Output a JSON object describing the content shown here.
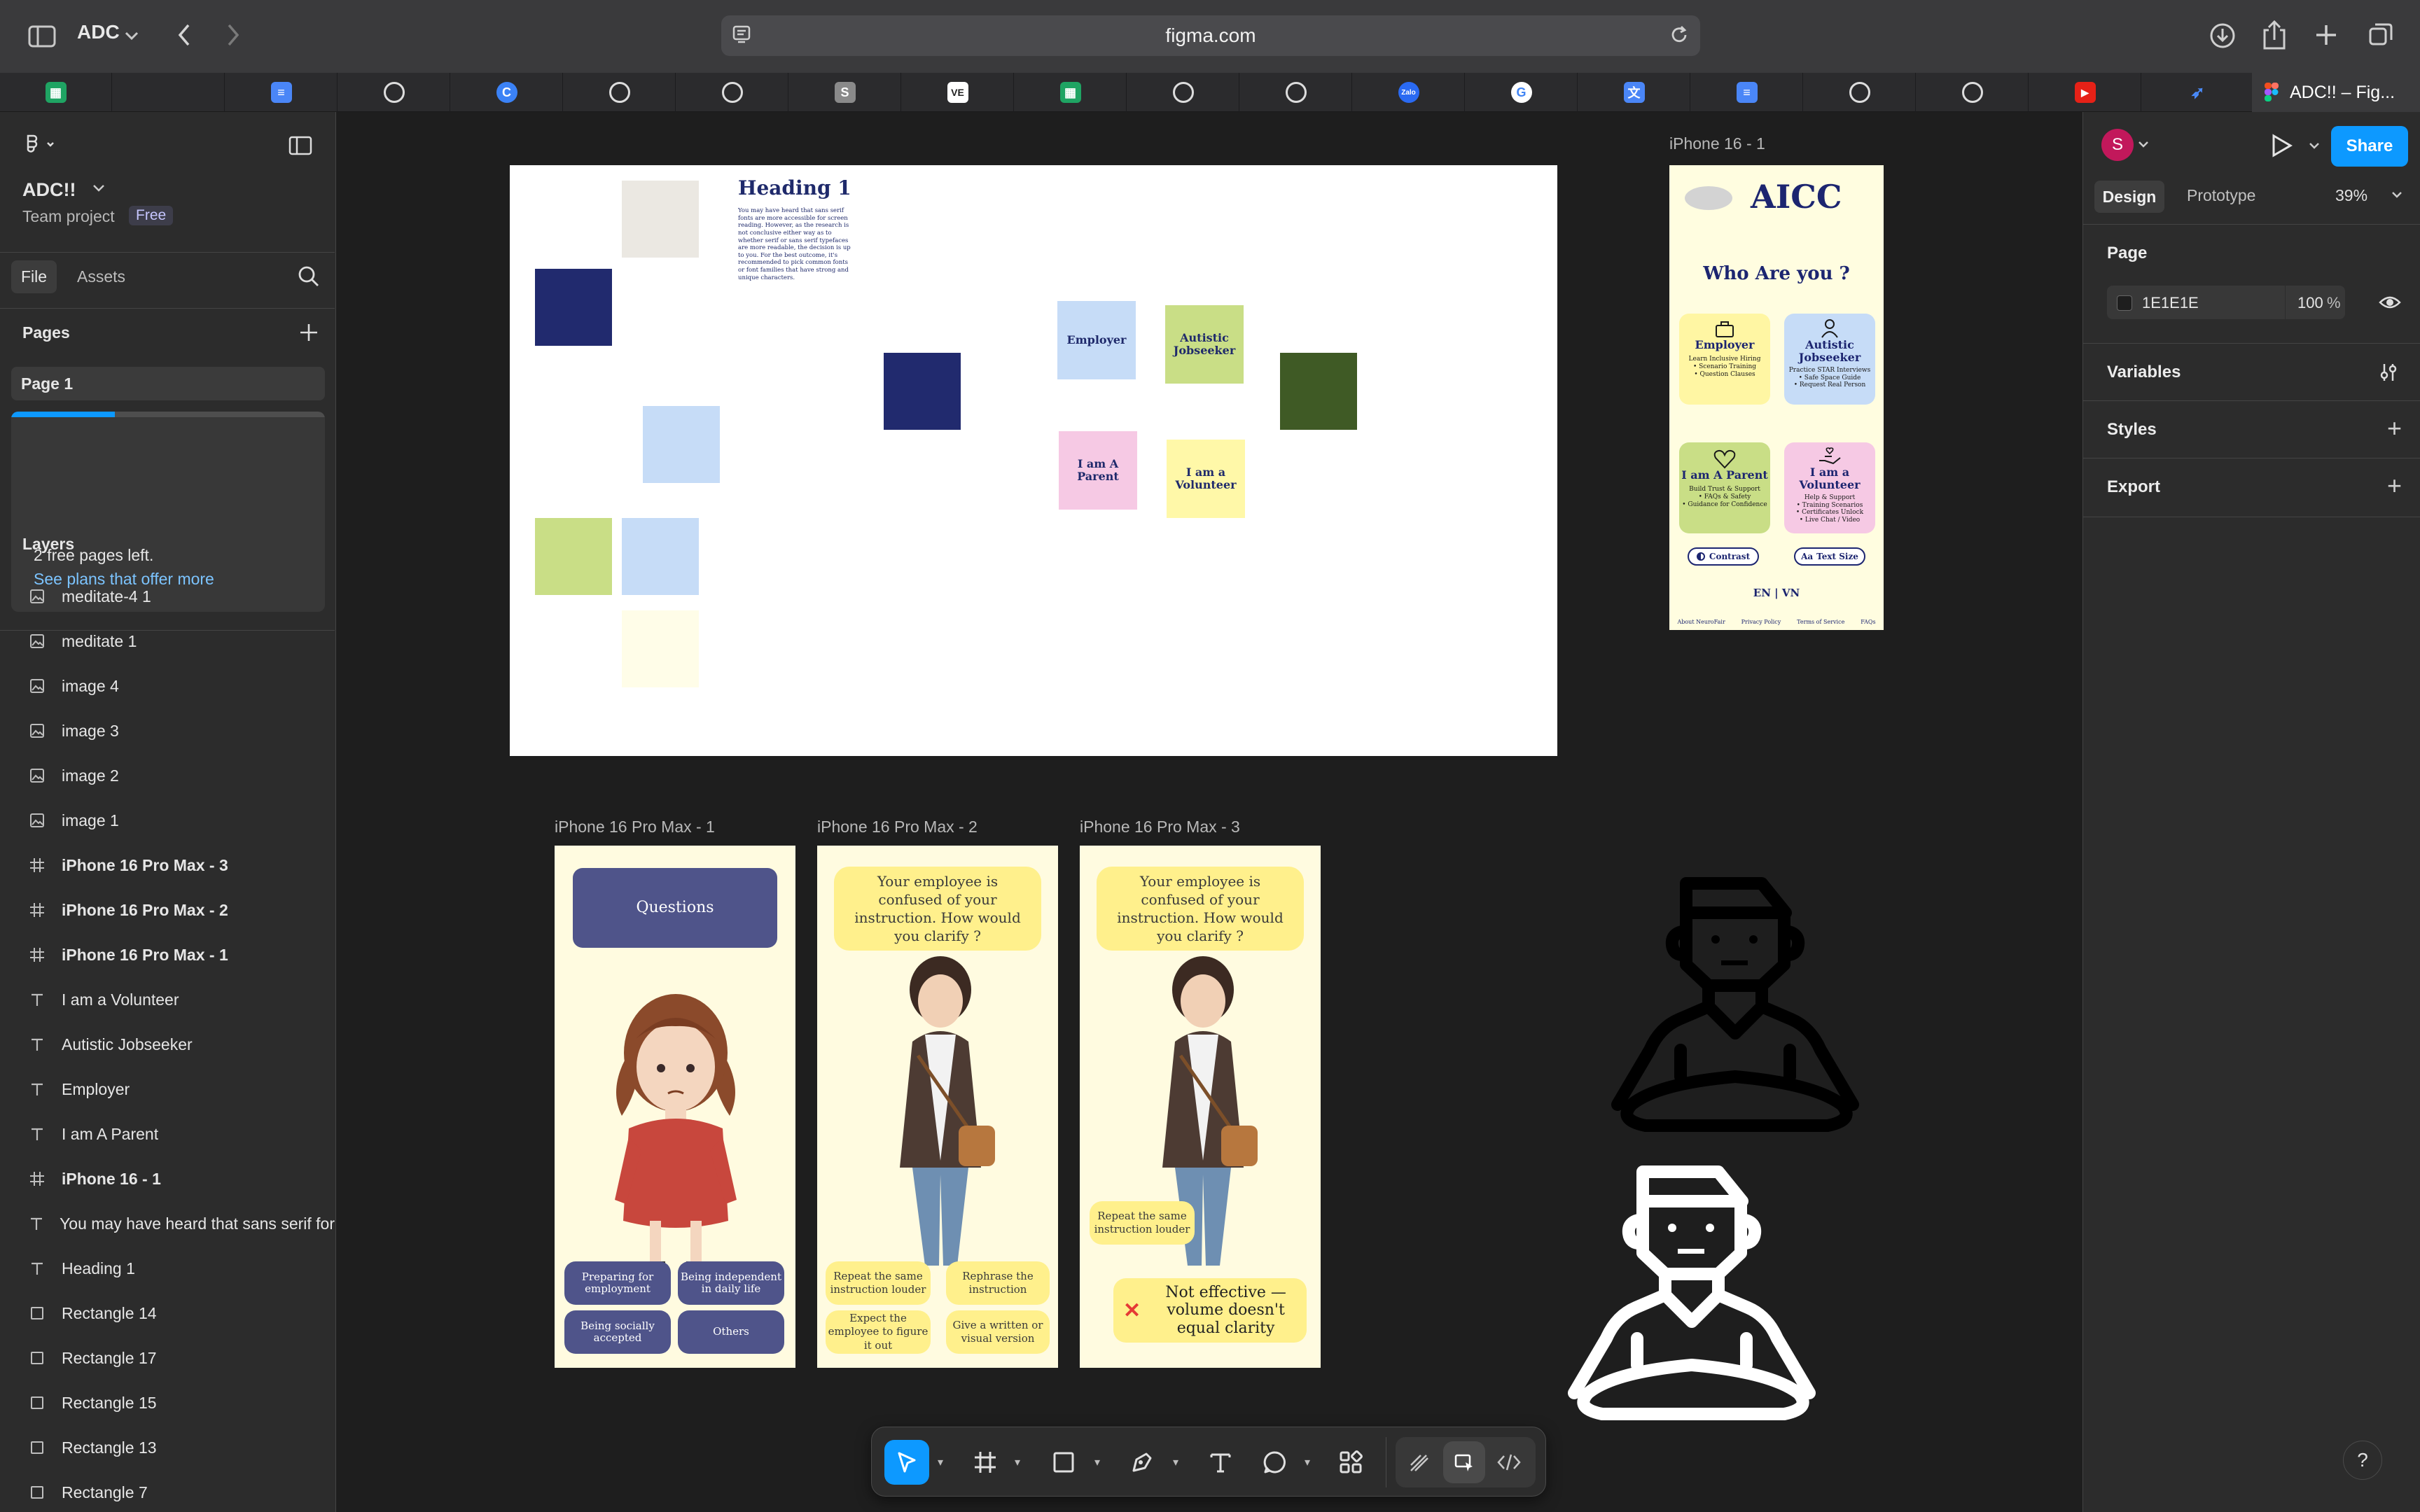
{
  "browser": {
    "profile": "ADC",
    "url": "figma.com",
    "active_tab_title": "ADC!! – Fig...",
    "tab_icons": [
      "sheets-icon",
      "blank-tab",
      "docs-icon",
      "chatgpt-icon",
      "canva-icon",
      "chatgpt-icon",
      "chatgpt-icon",
      "s-icon",
      "vnexpress-icon",
      "sheets-icon",
      "chatgpt-icon",
      "chatgpt-icon",
      "zalo-icon",
      "google-icon",
      "translate-icon",
      "docs-icon",
      "chatgpt-icon",
      "chatgpt-icon",
      "youtube-icon",
      "app-icon"
    ]
  },
  "left_panel": {
    "file_name": "ADC!!",
    "team": "Team project",
    "plan_badge": "Free",
    "tabs": {
      "file": "File",
      "assets": "Assets"
    },
    "pages_heading": "Pages",
    "page_item": "Page 1",
    "free_pages_note": "2 free pages left.",
    "plans_link": "See plans that offer more",
    "plan_progress": 0.33,
    "layers_heading": "Layers",
    "layers": [
      {
        "name": "meditate-4 1",
        "kind": "image"
      },
      {
        "name": "meditate 1",
        "kind": "image"
      },
      {
        "name": "image 4",
        "kind": "image"
      },
      {
        "name": "image 3",
        "kind": "image"
      },
      {
        "name": "image 2",
        "kind": "image"
      },
      {
        "name": "image 1",
        "kind": "image"
      },
      {
        "name": "iPhone 16 Pro Max - 3",
        "kind": "frame"
      },
      {
        "name": "iPhone 16 Pro Max - 2",
        "kind": "frame"
      },
      {
        "name": "iPhone 16 Pro Max - 1",
        "kind": "frame"
      },
      {
        "name": "I am a Volunteer",
        "kind": "text"
      },
      {
        "name": "Autistic Jobseeker",
        "kind": "text"
      },
      {
        "name": "Employer",
        "kind": "text"
      },
      {
        "name": "I am A Parent",
        "kind": "text"
      },
      {
        "name": "iPhone 16 - 1",
        "kind": "frame"
      },
      {
        "name": "You may have heard that sans serif for",
        "kind": "text"
      },
      {
        "name": "Heading 1",
        "kind": "text"
      },
      {
        "name": "Rectangle 14",
        "kind": "rect"
      },
      {
        "name": "Rectangle 17",
        "kind": "rect"
      },
      {
        "name": "Rectangle 15",
        "kind": "rect"
      },
      {
        "name": "Rectangle 13",
        "kind": "rect"
      },
      {
        "name": "Rectangle 7",
        "kind": "rect"
      }
    ]
  },
  "right_panel": {
    "avatar_letter": "S",
    "share": "Share",
    "tabs": {
      "design": "Design",
      "prototype": "Prototype"
    },
    "zoom": "39%",
    "page_heading": "Page",
    "bg_color": "1E1E1E",
    "bg_opacity": "100",
    "percent": "%",
    "sections": [
      "Variables",
      "Styles",
      "Export"
    ]
  },
  "canvas": {
    "style_guide": {
      "heading": "Heading 1",
      "body": "You may have heard that sans serif fonts are more accessible for screen reading. However, as the research is not conclusive either way as to whether serif or sans serif typefaces are more readable, the decision is up to you. For the best outcome, it's recommended to pick common fonts or font families that have strong and unique characters.",
      "stickies": [
        "Employer",
        "Autistic Jobseeker",
        "I am A Parent",
        "I am a Volunteer"
      ],
      "colors": {
        "navy": "#212a6e",
        "light_blue": "#c6dcf7",
        "green": "#c9de86",
        "dark_green": "#3f5a25",
        "cream": "#fffde8",
        "beige": "#ebe8e2",
        "pink": "#f6c9e4",
        "yellow": "#fff8a8"
      }
    },
    "iphone16": {
      "label": "iPhone 16 - 1",
      "logo": "AICC",
      "question": "Who Are you ?",
      "cards": [
        {
          "title": "Employer",
          "sub": "Learn Inclusive Hiring\n• Scenario Training\n• Question Clauses",
          "color": "#fff6a3"
        },
        {
          "title": "Autistic Jobseeker",
          "sub": "Practice STAR Interviews\n• Safe Space Guide\n• Request Real Person",
          "color": "#c6dcf7"
        },
        {
          "title": "I am A Parent",
          "sub": "Build Trust & Support\n• FAQs & Safety\n• Guidance for Confidence",
          "color": "#c9de86"
        },
        {
          "title": "I am a Volunteer",
          "sub": "Help & Support\n• Training Scenarios\n• Certificates Unlock\n• Live Chat / Video",
          "color": "#f6c9e4"
        }
      ],
      "contrast": "Contrast",
      "text_size": "Text Size",
      "lang": "EN | VN",
      "footer": [
        "About NeuroFair",
        "Privacy Policy",
        "Terms of Service",
        "FAQs"
      ]
    },
    "pro1": {
      "label": "iPhone 16 Pro Max - 1",
      "header": "Questions",
      "options": [
        "Preparing for employment",
        "Being independent in daily life",
        "Being socially accepted",
        "Others"
      ]
    },
    "pro2": {
      "label": "iPhone 16 Pro Max - 2",
      "question": "Your employee is confused of your instruction. How would you clarify ?",
      "options": [
        "Repeat the same instruction louder",
        "Rephrase the instruction",
        "Expect the employee to figure it out",
        "Give a written or visual version"
      ]
    },
    "pro3": {
      "label": "iPhone 16 Pro Max - 3",
      "question": "Your employee is confused of your instruction. How would you clarify ?",
      "chosen": "Repeat the same instruction louder",
      "feedback": "Not effective — volume doesn't equal clarity"
    }
  },
  "toolbar": {
    "tools": [
      "move-tool",
      "frame-tool",
      "rectangle-tool",
      "pen-tool",
      "text-tool",
      "comment-tool",
      "actions-tool",
      "draw-mode",
      "design-mode",
      "dev-mode"
    ]
  },
  "help": "?"
}
